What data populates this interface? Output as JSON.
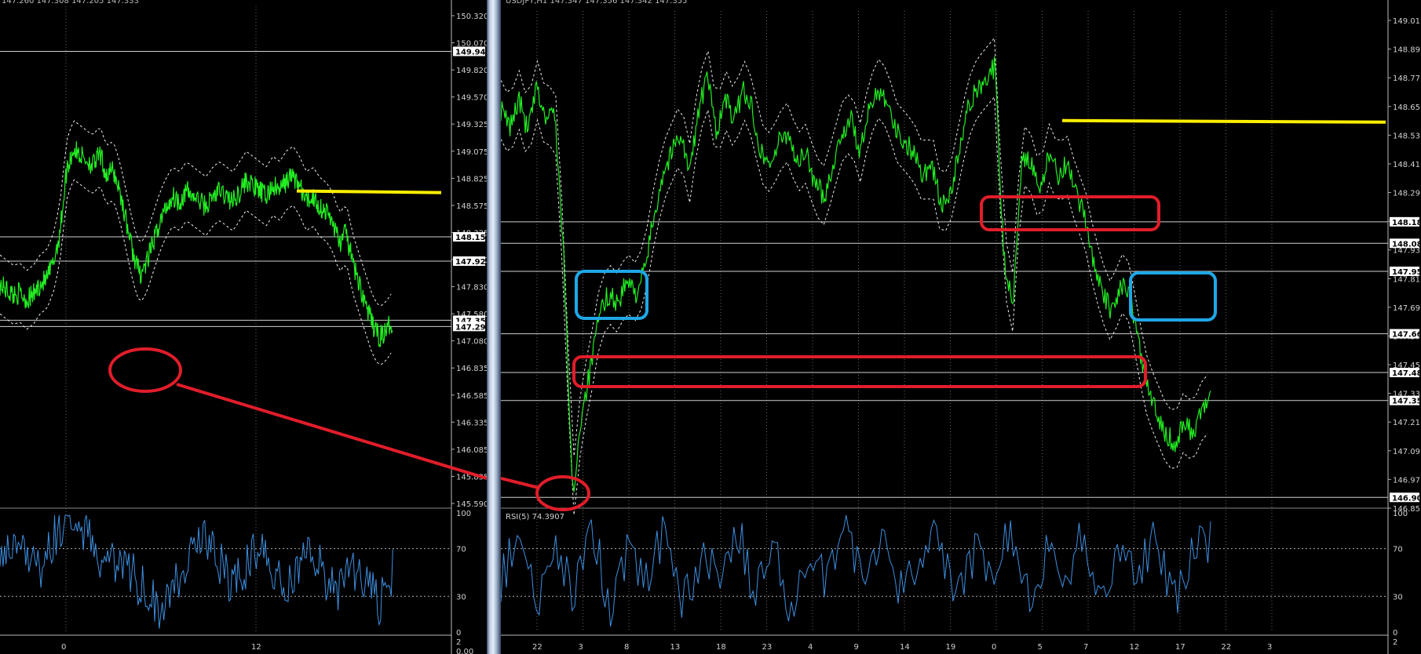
{
  "left_window": {
    "header": "147.260 147.308 147.205 147.333",
    "price_axis": [
      "150.320",
      "150.070",
      "149.820",
      "149.570",
      "149.325",
      "149.075",
      "148.825",
      "148.575",
      "148.325",
      "148.080",
      "147.830",
      "147.580",
      "147.080",
      "146.835",
      "146.585",
      "146.335",
      "146.085",
      "145.835",
      "145.590"
    ],
    "time_axis": [
      "0",
      "12"
    ],
    "level_boxes": [
      "149.946",
      "148.159",
      "147.925",
      "147.355",
      "147.295"
    ],
    "rsi_axis": [
      "100",
      "70",
      "30",
      "0"
    ],
    "bottom_axis": [
      "2",
      "0.00"
    ]
  },
  "right_window": {
    "header": "USDJPY,H1 147.347 147.356 147.342 147.355",
    "price_axis": [
      "149.01",
      "148.89",
      "148.77",
      "148.65",
      "148.53",
      "148.41",
      "148.29",
      "148.05",
      "147.93",
      "147.81",
      "147.69",
      "147.57",
      "147.45",
      "147.33",
      "147.21",
      "147.09",
      "146.97",
      "146.85"
    ],
    "time_axis": [
      "22",
      "3",
      "8",
      "13",
      "18",
      "23",
      "4",
      "9",
      "14",
      "19",
      "0",
      "5",
      "7",
      "12",
      "17",
      "22",
      "3"
    ],
    "level_boxes": [
      "148.18",
      "148.08",
      "147.95",
      "147.66",
      "147.48",
      "147.35",
      "146.90"
    ],
    "rsi_label": "RSI(5) 74.3907",
    "rsi_axis": [
      "100",
      "70",
      "30",
      "0"
    ],
    "bottom_axis": [
      "2"
    ]
  },
  "colors": {
    "background": "#000000",
    "price": "#22ee22",
    "rsi": "#3d8fe0",
    "resistance": "#ffee00",
    "zone_red": "#e11d2a",
    "zone_blue": "#1fa7e6",
    "level_line": "#cfcfcf"
  },
  "chart_data": [
    {
      "type": "line",
      "symbol": "USDJPY",
      "panel": "left",
      "y_range": [
        145.59,
        150.32
      ],
      "series": [
        {
          "x": [
            0,
            1,
            2,
            3,
            4,
            5,
            6,
            7,
            8,
            9,
            10,
            11,
            12,
            13,
            14,
            15,
            16,
            17,
            18,
            19,
            20,
            21,
            22,
            23,
            24,
            25,
            26,
            27,
            28,
            29,
            30,
            31,
            32,
            33,
            34,
            35,
            36,
            37,
            38,
            39,
            40,
            41,
            42,
            43,
            44,
            45,
            46,
            47,
            48,
            49,
            50,
            51,
            52,
            53,
            54,
            55,
            56,
            57,
            58,
            59
          ],
          "values": [
            147.7,
            147.65,
            147.6,
            147.62,
            147.55,
            147.6,
            147.7,
            147.75,
            147.9,
            148.2,
            148.8,
            149.0,
            148.95,
            148.9,
            148.85,
            148.95,
            148.75,
            148.8,
            148.6,
            148.3,
            148.0,
            147.8,
            147.9,
            148.1,
            148.3,
            148.45,
            148.55,
            148.5,
            148.6,
            148.55,
            148.5,
            148.45,
            148.55,
            148.6,
            148.55,
            148.5,
            148.6,
            148.7,
            148.65,
            148.6,
            148.55,
            148.65,
            148.6,
            148.7,
            148.75,
            148.65,
            148.5,
            148.55,
            148.45,
            148.4,
            148.3,
            148.1,
            148.2,
            147.9,
            147.7,
            147.5,
            147.3,
            147.2,
            147.25,
            147.35
          ]
        }
      ],
      "lows_marked": [
        146.9
      ]
    },
    {
      "type": "line",
      "symbol": "USDJPY",
      "timeframe": "H1",
      "panel": "right",
      "y_range": [
        146.85,
        149.13
      ],
      "series": [
        {
          "x": [
            0,
            1,
            2,
            3,
            4,
            5,
            6,
            7,
            8,
            9,
            10,
            11,
            12,
            13,
            14,
            15,
            16,
            17,
            18,
            19,
            20,
            21,
            22,
            23,
            24,
            25,
            26,
            27,
            28,
            29,
            30,
            31,
            32,
            33,
            34,
            35,
            36,
            37,
            38,
            39,
            40,
            41,
            42,
            43,
            44,
            45,
            46,
            47,
            48,
            49,
            50,
            51,
            52,
            53,
            54,
            55,
            56,
            57,
            58,
            59,
            60,
            61,
            62,
            63,
            64,
            65,
            66,
            67,
            68,
            69,
            70,
            71,
            72,
            73,
            74,
            75,
            76,
            77,
            78,
            79
          ],
          "values": [
            148.7,
            148.62,
            148.75,
            148.6,
            148.8,
            148.65,
            148.7,
            148.0,
            146.9,
            147.3,
            147.5,
            147.75,
            147.85,
            147.8,
            147.9,
            147.85,
            147.95,
            148.2,
            148.4,
            148.5,
            148.6,
            148.4,
            148.7,
            148.85,
            148.6,
            148.75,
            148.65,
            148.8,
            148.7,
            148.5,
            148.45,
            148.55,
            148.6,
            148.45,
            148.5,
            148.35,
            148.3,
            148.45,
            148.6,
            148.65,
            148.5,
            148.7,
            148.8,
            148.75,
            148.6,
            148.55,
            148.5,
            148.4,
            148.45,
            148.25,
            148.3,
            148.5,
            148.7,
            148.8,
            148.85,
            148.9,
            148.0,
            147.8,
            148.5,
            148.45,
            148.3,
            148.5,
            148.4,
            148.45,
            148.3,
            148.2,
            148.0,
            147.85,
            147.75,
            147.9,
            147.85,
            147.6,
            147.4,
            147.3,
            147.2,
            147.15,
            147.25,
            147.2,
            147.3,
            147.35
          ]
        }
      ],
      "resistance": 148.65,
      "zones": [
        {
          "color": "red",
          "from": 148.12,
          "to": 148.24
        },
        {
          "color": "red",
          "from": 147.4,
          "to": 147.52
        },
        {
          "color": "blue",
          "from": 147.75,
          "to": 147.88
        }
      ]
    },
    {
      "type": "line",
      "name": "RSI(5) 74.3907",
      "panel": "right-rsi",
      "y_range": [
        0,
        100
      ],
      "series": [
        {
          "x": [
            0,
            1,
            2,
            3,
            4,
            5,
            6,
            7,
            8,
            9,
            10,
            11,
            12,
            13,
            14,
            15,
            16,
            17,
            18,
            19,
            20,
            21,
            22,
            23,
            24,
            25,
            26,
            27,
            28,
            29,
            30,
            31,
            32,
            33,
            34,
            35,
            36,
            37,
            38,
            39
          ],
          "values": [
            45,
            80,
            20,
            65,
            35,
            90,
            15,
            70,
            40,
            85,
            25,
            60,
            50,
            88,
            30,
            72,
            18,
            66,
            42,
            92,
            28,
            75,
            35,
            58,
            82,
            22,
            68,
            45,
            90,
            30,
            70,
            40,
            86,
            20,
            62,
            48,
            80,
            25,
            70,
            74
          ]
        }
      ]
    },
    {
      "type": "line",
      "name": "RSI",
      "panel": "left-rsi",
      "y_range": [
        0,
        100
      ],
      "series": [
        {
          "x": [
            0,
            1,
            2,
            3,
            4,
            5,
            6,
            7,
            8,
            9,
            10,
            11,
            12,
            13,
            14,
            15,
            16,
            17,
            18,
            19,
            20,
            21,
            22,
            23,
            24,
            25,
            26,
            27,
            28,
            29
          ],
          "values": [
            75,
            70,
            60,
            55,
            80,
            95,
            85,
            70,
            55,
            60,
            45,
            30,
            20,
            45,
            60,
            75,
            65,
            40,
            50,
            70,
            55,
            35,
            60,
            72,
            45,
            30,
            55,
            40,
            25,
            50
          ]
        }
      ]
    }
  ]
}
